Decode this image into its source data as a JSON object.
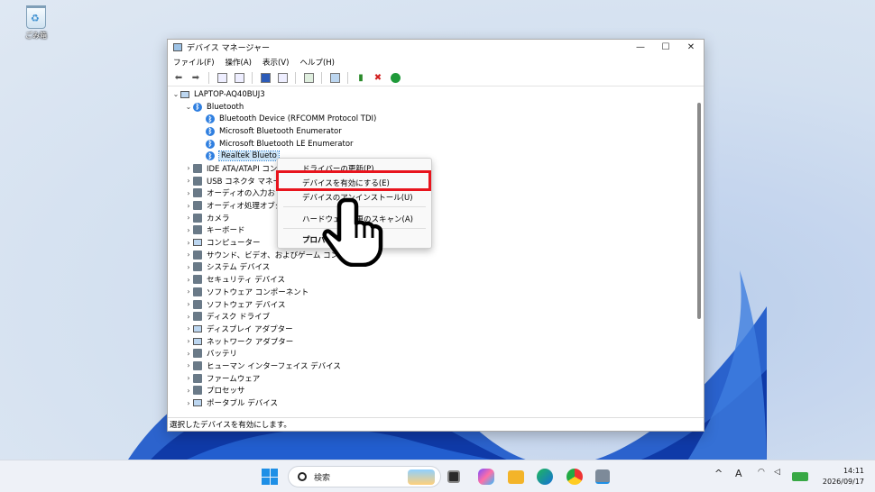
{
  "desktop": {
    "recycle_bin_label": "ごみ箱"
  },
  "window": {
    "title": "デバイス マネージャー",
    "controls": {
      "minimize": "—",
      "maximize": "☐",
      "close": "✕"
    },
    "menu": [
      "ファイル(F)",
      "操作(A)",
      "表示(V)",
      "ヘルプ(H)"
    ],
    "status": "選択したデバイスを有効にします。"
  },
  "tree": [
    {
      "label": "LAPTOP-AQ40BUJ3",
      "indent": 0,
      "chevron": "⌄",
      "icon": "computer-icon",
      "kind": "pc"
    },
    {
      "label": "Bluetooth",
      "indent": 1,
      "chevron": "⌄",
      "icon": "bluetooth-icon",
      "kind": "bt"
    },
    {
      "label": "Bluetooth Device (RFCOMM Protocol TDI)",
      "indent": 2,
      "chevron": "",
      "icon": "bluetooth-icon",
      "kind": "bt"
    },
    {
      "label": "Microsoft Bluetooth Enumerator",
      "indent": 2,
      "chevron": "",
      "icon": "bluetooth-icon",
      "kind": "bt"
    },
    {
      "label": "Microsoft Bluetooth LE Enumerator",
      "indent": 2,
      "chevron": "",
      "icon": "bluetooth-icon",
      "kind": "bt"
    },
    {
      "label": "Realtek Blueto",
      "indent": 2,
      "chevron": "",
      "icon": "bluetooth-disabled-icon",
      "kind": "bt",
      "selected": true
    },
    {
      "label": "IDE ATA/ATAPI コント",
      "indent": 1,
      "chevron": "›",
      "icon": "ide-icon",
      "kind": "dev"
    },
    {
      "label": "USB コネクタ マネー",
      "indent": 1,
      "chevron": "›",
      "icon": "usb-icon",
      "kind": "dev"
    },
    {
      "label": "オーディオの入力お",
      "indent": 1,
      "chevron": "›",
      "icon": "audio-input-icon",
      "kind": "dev"
    },
    {
      "label": "オーディオ処理オブジ",
      "indent": 1,
      "chevron": "›",
      "icon": "audio-processing-icon",
      "kind": "dev"
    },
    {
      "label": "カメラ",
      "indent": 1,
      "chevron": "›",
      "icon": "camera-icon",
      "kind": "dev"
    },
    {
      "label": "キーボード",
      "indent": 1,
      "chevron": "›",
      "icon": "keyboard-icon",
      "kind": "dev"
    },
    {
      "label": "コンピューター",
      "indent": 1,
      "chevron": "›",
      "icon": "computer-icon",
      "kind": "pc"
    },
    {
      "label": "サウンド、ビデオ、およびゲーム コントローラー",
      "indent": 1,
      "chevron": "›",
      "icon": "sound-icon",
      "kind": "dev"
    },
    {
      "label": "システム デバイス",
      "indent": 1,
      "chevron": "›",
      "icon": "system-device-icon",
      "kind": "dev"
    },
    {
      "label": "セキュリティ デバイス",
      "indent": 1,
      "chevron": "›",
      "icon": "security-device-icon",
      "kind": "dev"
    },
    {
      "label": "ソフトウェア コンポーネント",
      "indent": 1,
      "chevron": "›",
      "icon": "software-component-icon",
      "kind": "dev"
    },
    {
      "label": "ソフトウェア デバイス",
      "indent": 1,
      "chevron": "›",
      "icon": "software-device-icon",
      "kind": "dev"
    },
    {
      "label": "ディスク ドライブ",
      "indent": 1,
      "chevron": "›",
      "icon": "disk-drive-icon",
      "kind": "dev"
    },
    {
      "label": "ディスプレイ アダプター",
      "indent": 1,
      "chevron": "›",
      "icon": "display-adapter-icon",
      "kind": "pc"
    },
    {
      "label": "ネットワーク アダプター",
      "indent": 1,
      "chevron": "›",
      "icon": "network-adapter-icon",
      "kind": "pc"
    },
    {
      "label": "バッテリ",
      "indent": 1,
      "chevron": "›",
      "icon": "battery-icon",
      "kind": "dev"
    },
    {
      "label": "ヒューマン インターフェイス デバイス",
      "indent": 1,
      "chevron": "›",
      "icon": "hid-icon",
      "kind": "dev"
    },
    {
      "label": "ファームウェア",
      "indent": 1,
      "chevron": "›",
      "icon": "firmware-icon",
      "kind": "dev"
    },
    {
      "label": "プロセッサ",
      "indent": 1,
      "chevron": "›",
      "icon": "processor-icon",
      "kind": "dev"
    },
    {
      "label": "ポータブル デバイス",
      "indent": 1,
      "chevron": "›",
      "icon": "portable-device-icon",
      "kind": "pc"
    }
  ],
  "context_menu": {
    "update_driver": "ドライバーの更新(P)",
    "enable_device": "デバイスを有効にする(E)",
    "uninstall_device": "デバイスのアンインストール(U)",
    "scan_hardware": "ハードウェア変更のスキャン(A)",
    "properties": "プロパティ"
  },
  "taskbar": {
    "search_placeholder": "検索",
    "clock_time": "14:11",
    "clock_date": "2026/09/17",
    "ime": "A"
  },
  "colors": {
    "highlight": "#e8141d",
    "accent": "#1e8fe6"
  }
}
